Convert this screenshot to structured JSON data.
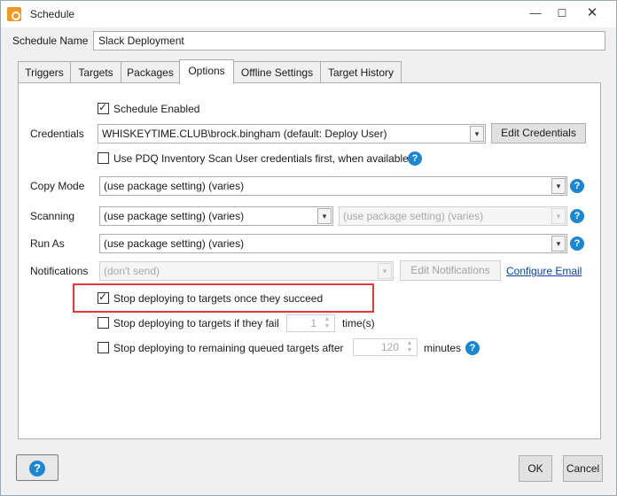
{
  "window": {
    "title": "Schedule",
    "min_glyph": "—",
    "max_glyph": "☐",
    "close_glyph": "✕"
  },
  "schedule_name": {
    "label": "Schedule Name",
    "value": "Slack Deployment"
  },
  "tabs": [
    {
      "label": "Triggers"
    },
    {
      "label": "Targets"
    },
    {
      "label": "Packages"
    },
    {
      "label": "Options",
      "active": true
    },
    {
      "label": "Offline Settings"
    },
    {
      "label": "Target History"
    }
  ],
  "options": {
    "schedule_enabled": {
      "label": "Schedule Enabled",
      "checked": true
    },
    "credentials": {
      "label": "Credentials",
      "value": "WHISKEYTIME.CLUB\\brock.bingham (default: Deploy User)",
      "edit_button": "Edit Credentials"
    },
    "pdq_inventory": {
      "label": "Use PDQ Inventory Scan User credentials first, when available",
      "checked": false
    },
    "copy_mode": {
      "label": "Copy Mode",
      "value": "(use package setting) (varies)"
    },
    "scanning": {
      "label": "Scanning",
      "value": "(use package setting) (varies)",
      "secondary_value": "(use package setting) (varies)"
    },
    "run_as": {
      "label": "Run As",
      "value": "(use package setting) (varies)"
    },
    "notifications": {
      "label": "Notifications",
      "value": "(don't send)",
      "edit_button": "Edit Notifications",
      "configure_link": "Configure Email"
    },
    "stop_on_success": {
      "label": "Stop deploying to targets once they succeed",
      "checked": true
    },
    "stop_on_fail": {
      "label": "Stop deploying to targets if they fail",
      "checked": false,
      "value": "1",
      "unit": "time(s)"
    },
    "stop_queued": {
      "label": "Stop deploying to remaining queued targets after",
      "checked": false,
      "value": "120",
      "unit": "minutes"
    }
  },
  "footer": {
    "ok": "OK",
    "cancel": "Cancel"
  },
  "icons": {
    "help": "?",
    "dropdown": "▾"
  },
  "colors": {
    "accent": "#1b87d3",
    "highlight": "#e03a3a",
    "app_icon": "#f29722"
  }
}
